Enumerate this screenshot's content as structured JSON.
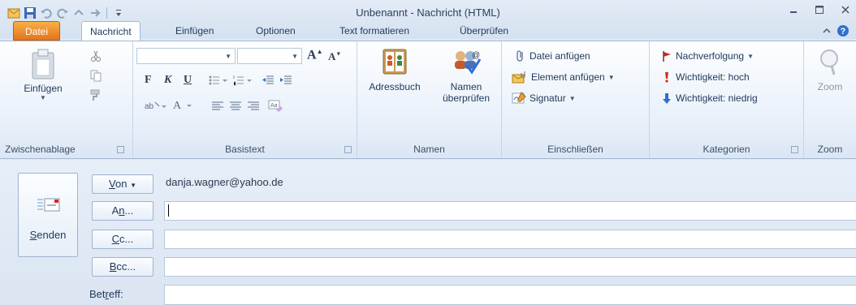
{
  "window": {
    "title": "Unbenannt - Nachricht (HTML)"
  },
  "tabs": [
    {
      "label": "Datei"
    },
    {
      "label": "Nachricht"
    },
    {
      "label": "Einfügen"
    },
    {
      "label": "Optionen"
    },
    {
      "label": "Text formatieren"
    },
    {
      "label": "Überprüfen"
    }
  ],
  "ribbon": {
    "clipboard": {
      "paste_label": "Einfügen",
      "group_label": "Zwischenablage"
    },
    "basictext": {
      "group_label": "Basistext",
      "grow": "A",
      "shrink": "A",
      "bold": "F",
      "italic": "K",
      "underline": "U"
    },
    "names": {
      "addressbook_label": "Adressbuch",
      "checknames_line1": "Namen",
      "checknames_line2": "überprüfen",
      "group_label": "Namen"
    },
    "include": {
      "attach_file": "Datei anfügen",
      "attach_item": "Element anfügen",
      "signature": "Signatur",
      "group_label": "Einschließen"
    },
    "tags": {
      "followup": "Nachverfolgung",
      "importance_high": "Wichtigkeit: hoch",
      "importance_low": "Wichtigkeit: niedrig",
      "group_label": "Kategorien"
    },
    "zoom": {
      "zoom_label": "Zoom",
      "group_label": "Zoom"
    }
  },
  "compose": {
    "send_label_prefix": "",
    "send_label_u": "S",
    "send_label_rest": "enden",
    "from": {
      "u": "V",
      "rest": "on",
      "value": "danja.wagner@yahoo.de"
    },
    "to": {
      "pre": "A",
      "u": "n",
      "rest": "..."
    },
    "cc": {
      "u": "C",
      "rest": "c..."
    },
    "bcc": {
      "u": "B",
      "rest": "cc..."
    },
    "subject": {
      "pre": "Bet",
      "u": "r",
      "rest": "eff:"
    },
    "to_value": "",
    "cc_value": "",
    "bcc_value": "",
    "subject_value": ""
  }
}
